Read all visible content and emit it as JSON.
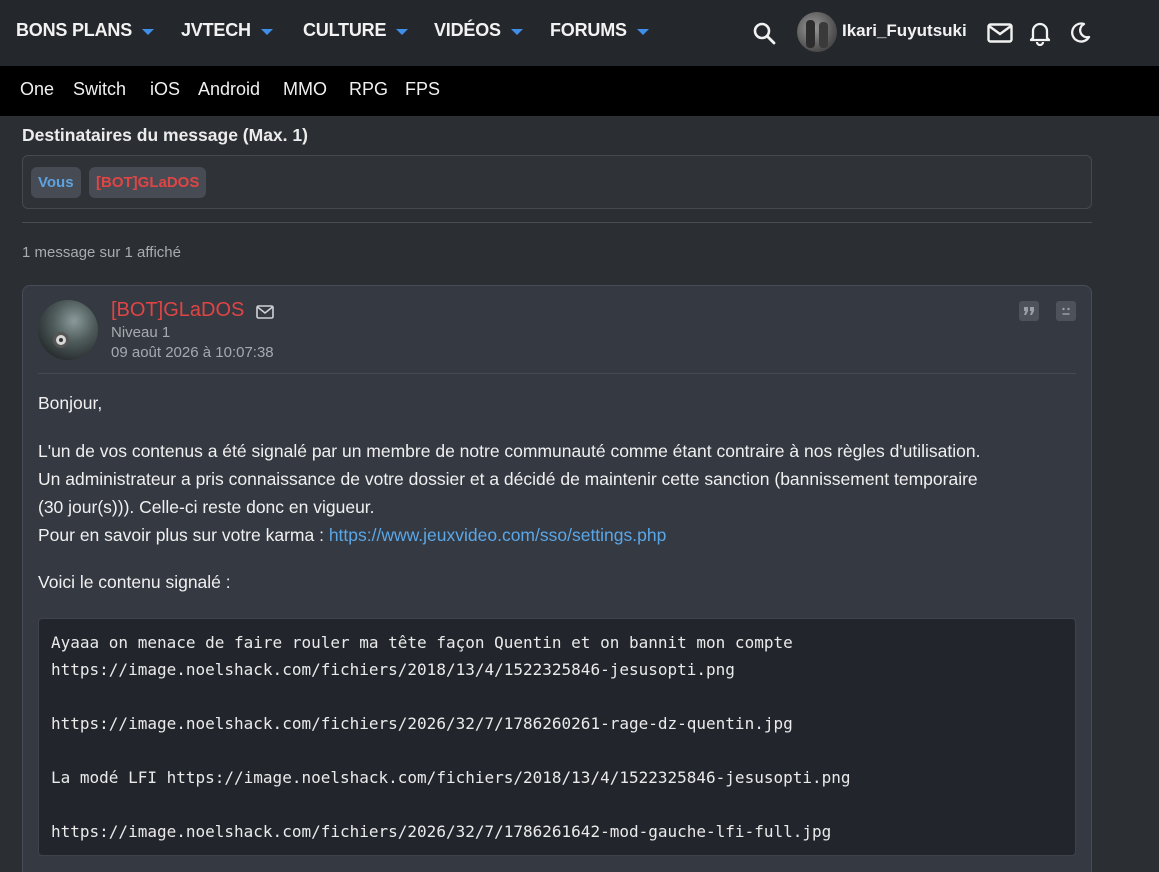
{
  "topnav": {
    "items": [
      {
        "label": "BONS PLANS"
      },
      {
        "label": "JVTECH"
      },
      {
        "label": "CULTURE"
      },
      {
        "label": "VIDÉOS"
      },
      {
        "label": "FORUMS"
      }
    ],
    "username": "Ikari_Fuyutsuki",
    "accent_color": "#3f8fe8"
  },
  "subnav": {
    "items": [
      "One",
      "Switch",
      "iOS",
      "Android",
      "MMO",
      "RPG",
      "FPS"
    ]
  },
  "recipients": {
    "title": "Destinataires du message (Max. 1)",
    "tags": [
      "Vous",
      "[BOT]GLaDOS"
    ]
  },
  "count_text": "1 message sur 1 affiché",
  "message": {
    "author": "[BOT]GLaDOS",
    "level": "Niveau 1",
    "date": "09 août 2026 à 10:07:38",
    "greeting": "Bonjour,",
    "para1_line1": "L'un de vos contenus a été signalé par un membre de notre communauté comme étant contraire à nos règles d'utilisation.",
    "para1_line2": "Un administrateur a pris connaissance de votre dossier et a décidé de maintenir cette sanction (bannissement temporaire",
    "para1_line3": "(30 jour(s))). Celle-ci reste donc en vigueur.",
    "para1_line4_prefix": "Pour en savoir plus sur votre karma : ",
    "karma_link": "https://www.jeuxvideo.com/sso/settings.php",
    "reported_intro": "Voici le contenu signalé :",
    "code_lines": [
      "Ayaaa on menace de faire rouler ma tête façon Quentin et on bannit mon compte",
      "https://image.noelshack.com/fichiers/2018/13/4/1522325846-jesusopti.png",
      "",
      "https://image.noelshack.com/fichiers/2026/32/7/1786260261-rage-dz-quentin.jpg",
      "",
      "La modé LFI https://image.noelshack.com/fichiers/2018/13/4/1522325846-jesusopti.png",
      "",
      "https://image.noelshack.com/fichiers/2026/32/7/1786261642-mod-gauche-lfi-full.jpg"
    ]
  }
}
